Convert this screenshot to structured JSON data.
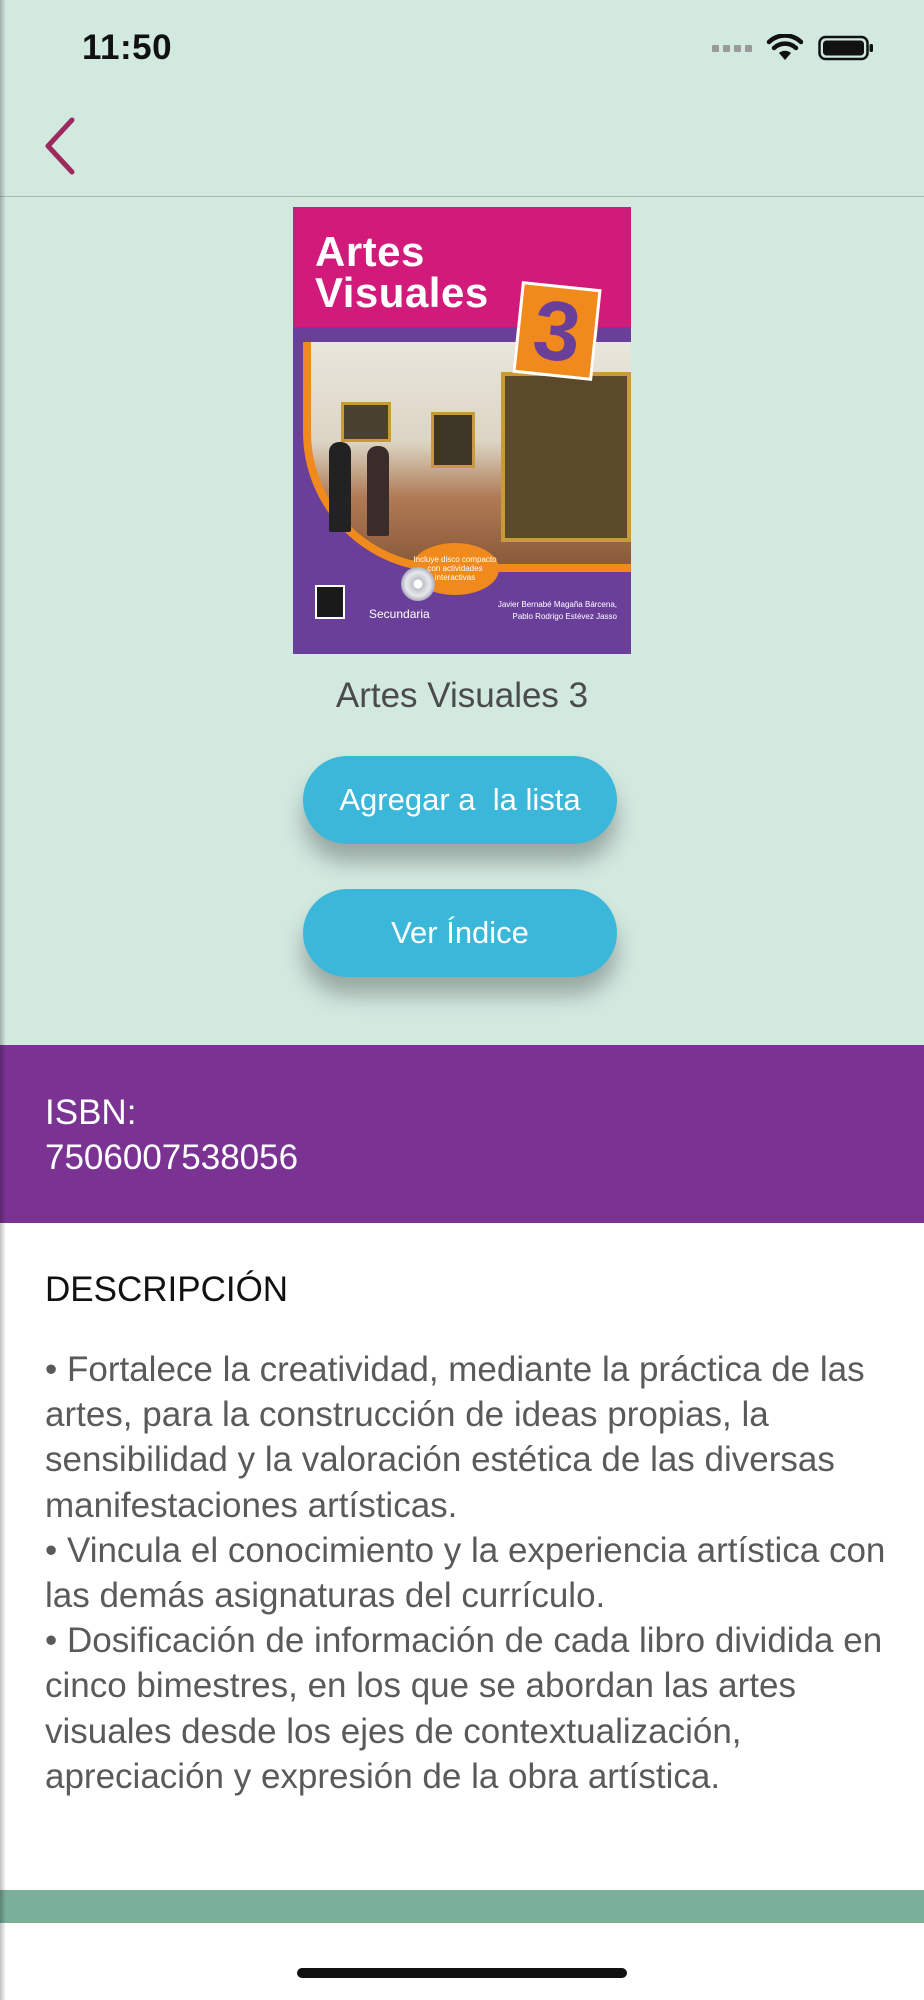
{
  "status_bar": {
    "time": "11:50",
    "icons": [
      "signal-icon",
      "wifi-icon",
      "battery-icon"
    ]
  },
  "nav": {
    "back_icon": "chevron-left-icon"
  },
  "cover": {
    "title": "Artes Visuales",
    "number": "3",
    "badge": "Incluye disco compacto con actividades interactivas",
    "imprint": "Secundaria",
    "authors": "Javier Bernabé Magaña Bárcena, Pablo Rodrigo Estévez Jasso"
  },
  "book": {
    "title": "Artes Visuales 3"
  },
  "buttons": {
    "add_to_list": "Agregar a  la lista",
    "view_index": "Ver Índice"
  },
  "isbn": {
    "label": "ISBN:",
    "value": "7506007538056"
  },
  "description": {
    "heading": "DESCRIPCIÓN",
    "items": [
      "• Fortalece la creatividad, mediante la práctica de las artes, para la construcción de ideas propias, la sensibilidad y la valoración estética de las diversas manifestaciones artísticas.",
      "• Vincula el conocimiento y la experiencia artística con las demás asignaturas del currículo.",
      "• Dosificación de información de cada libro dividida en cinco bimestres, en los que se abordan las artes visuales desde los ejes de contextualización, apreciación y expresión de la obra artística."
    ]
  },
  "colors": {
    "mint_background": "#d2e9e0",
    "accent_back": "#9c2a5e",
    "button": "#3ab7d9",
    "isbn_band": "#7a3393",
    "bottom_band": "#7aaf9a"
  }
}
